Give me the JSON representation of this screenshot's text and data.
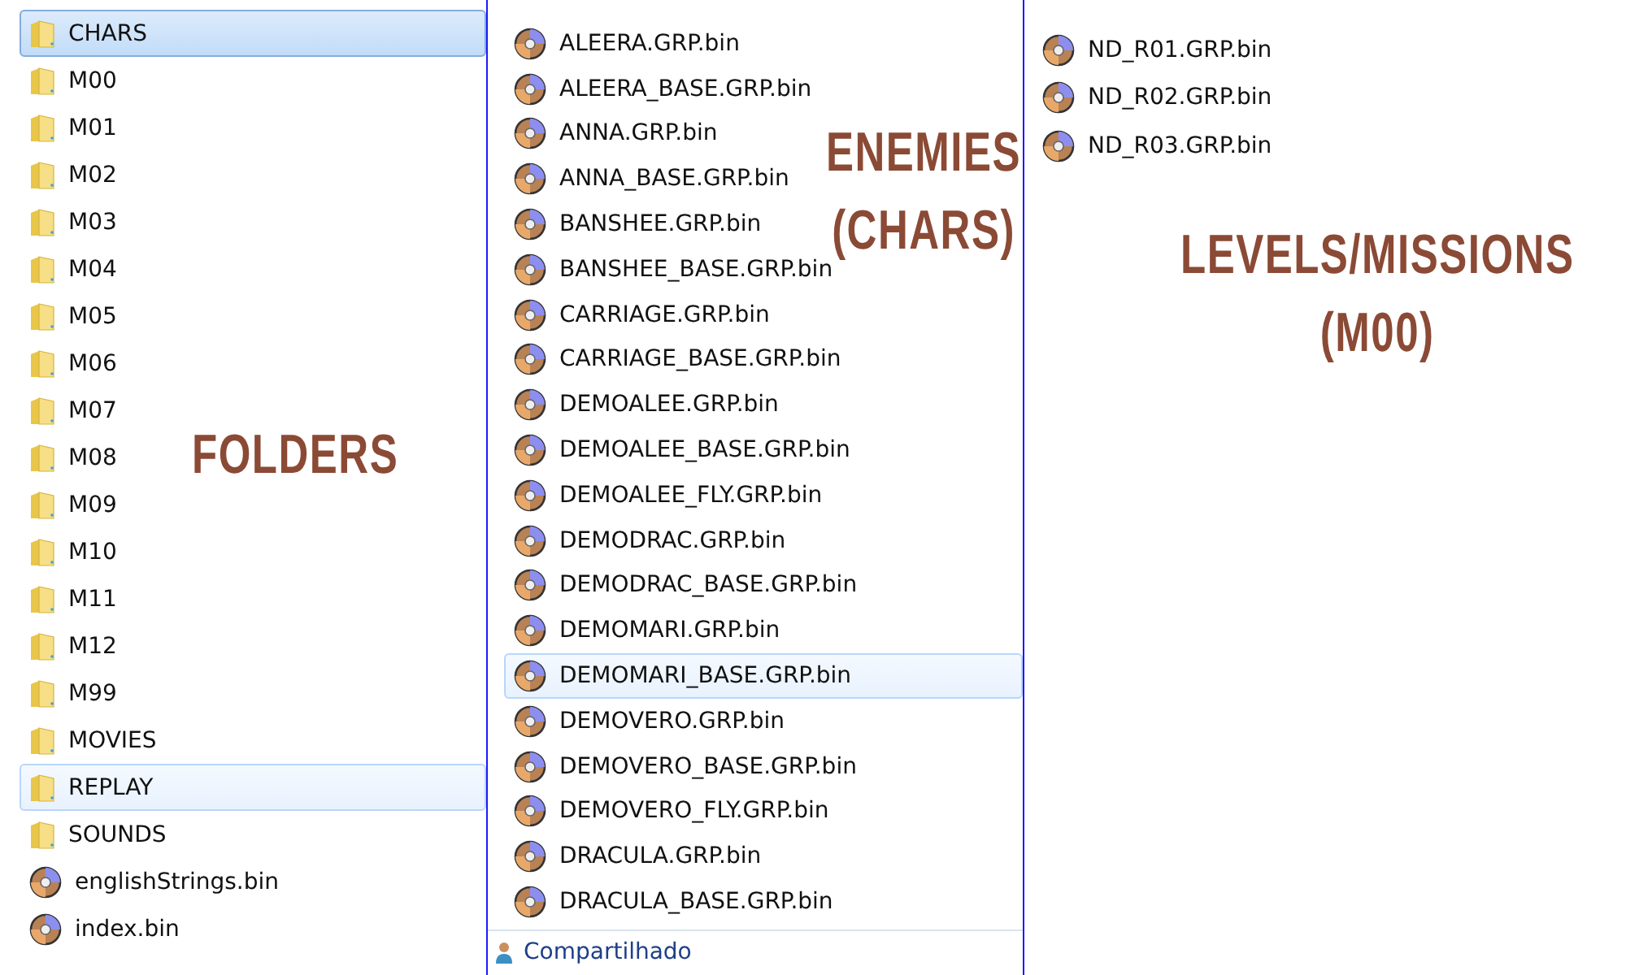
{
  "folders_pane": {
    "items": [
      {
        "kind": "folder",
        "name": "CHARS",
        "selected": true,
        "hovered": false
      },
      {
        "kind": "folder",
        "name": "M00",
        "selected": false,
        "hovered": false
      },
      {
        "kind": "folder",
        "name": "M01",
        "selected": false,
        "hovered": false
      },
      {
        "kind": "folder",
        "name": "M02",
        "selected": false,
        "hovered": false
      },
      {
        "kind": "folder",
        "name": "M03",
        "selected": false,
        "hovered": false
      },
      {
        "kind": "folder",
        "name": "M04",
        "selected": false,
        "hovered": false
      },
      {
        "kind": "folder",
        "name": "M05",
        "selected": false,
        "hovered": false
      },
      {
        "kind": "folder",
        "name": "M06",
        "selected": false,
        "hovered": false
      },
      {
        "kind": "folder",
        "name": "M07",
        "selected": false,
        "hovered": false
      },
      {
        "kind": "folder",
        "name": "M08",
        "selected": false,
        "hovered": false
      },
      {
        "kind": "folder",
        "name": "M09",
        "selected": false,
        "hovered": false
      },
      {
        "kind": "folder",
        "name": "M10",
        "selected": false,
        "hovered": false
      },
      {
        "kind": "folder",
        "name": "M11",
        "selected": false,
        "hovered": false
      },
      {
        "kind": "folder",
        "name": "M12",
        "selected": false,
        "hovered": false
      },
      {
        "kind": "folder",
        "name": "M99",
        "selected": false,
        "hovered": false
      },
      {
        "kind": "folder",
        "name": "MOVIES",
        "selected": false,
        "hovered": false
      },
      {
        "kind": "folder",
        "name": "REPLAY",
        "selected": false,
        "hovered": true
      },
      {
        "kind": "folder",
        "name": "SOUNDS",
        "selected": false,
        "hovered": false
      },
      {
        "kind": "file",
        "name": "englishStrings.bin",
        "selected": false,
        "hovered": false
      },
      {
        "kind": "file",
        "name": "index.bin",
        "selected": false,
        "hovered": false
      }
    ],
    "annotation": "FOLDERS"
  },
  "chars_pane": {
    "items": [
      {
        "kind": "file",
        "name": "ALEERA.GRP.bin",
        "selected": false,
        "hovered": false
      },
      {
        "kind": "file",
        "name": "ALEERA_BASE.GRP.bin",
        "selected": false,
        "hovered": false
      },
      {
        "kind": "file",
        "name": "ANNA.GRP.bin",
        "selected": false,
        "hovered": false
      },
      {
        "kind": "file",
        "name": "ANNA_BASE.GRP.bin",
        "selected": false,
        "hovered": false
      },
      {
        "kind": "file",
        "name": "BANSHEE.GRP.bin",
        "selected": false,
        "hovered": false
      },
      {
        "kind": "file",
        "name": "BANSHEE_BASE.GRP.bin",
        "selected": false,
        "hovered": false
      },
      {
        "kind": "file",
        "name": "CARRIAGE.GRP.bin",
        "selected": false,
        "hovered": false
      },
      {
        "kind": "file",
        "name": "CARRIAGE_BASE.GRP.bin",
        "selected": false,
        "hovered": false
      },
      {
        "kind": "file",
        "name": "DEMOALEE.GRP.bin",
        "selected": false,
        "hovered": false
      },
      {
        "kind": "file",
        "name": "DEMOALEE_BASE.GRP.bin",
        "selected": false,
        "hovered": false
      },
      {
        "kind": "file",
        "name": "DEMOALEE_FLY.GRP.bin",
        "selected": false,
        "hovered": false
      },
      {
        "kind": "file",
        "name": "DEMODRAC.GRP.bin",
        "selected": false,
        "hovered": false
      },
      {
        "kind": "file",
        "name": "DEMODRAC_BASE.GRP.bin",
        "selected": false,
        "hovered": false
      },
      {
        "kind": "file",
        "name": "DEMOMARI.GRP.bin",
        "selected": false,
        "hovered": false
      },
      {
        "kind": "file",
        "name": "DEMOMARI_BASE.GRP.bin",
        "selected": false,
        "hovered": true
      },
      {
        "kind": "file",
        "name": "DEMOVERO.GRP.bin",
        "selected": false,
        "hovered": false
      },
      {
        "kind": "file",
        "name": "DEMOVERO_BASE.GRP.bin",
        "selected": false,
        "hovered": false
      },
      {
        "kind": "file",
        "name": "DEMOVERO_FLY.GRP.bin",
        "selected": false,
        "hovered": false
      },
      {
        "kind": "file",
        "name": "DRACULA.GRP.bin",
        "selected": false,
        "hovered": false
      },
      {
        "kind": "file",
        "name": "DRACULA_BASE.GRP.bin",
        "selected": false,
        "hovered": false
      }
    ],
    "footer": "Compartilhado",
    "annotation": [
      "ENEMIES",
      "(CHARS)"
    ]
  },
  "levels_pane": {
    "items": [
      {
        "kind": "file",
        "name": "ND_R01.GRP.bin",
        "selected": false,
        "hovered": false
      },
      {
        "kind": "file",
        "name": "ND_R02.GRP.bin",
        "selected": false,
        "hovered": false
      },
      {
        "kind": "file",
        "name": "ND_R03.GRP.bin",
        "selected": false,
        "hovered": false
      }
    ],
    "annotation": [
      "LEVELS/MISSIONS",
      "(M00)"
    ]
  }
}
